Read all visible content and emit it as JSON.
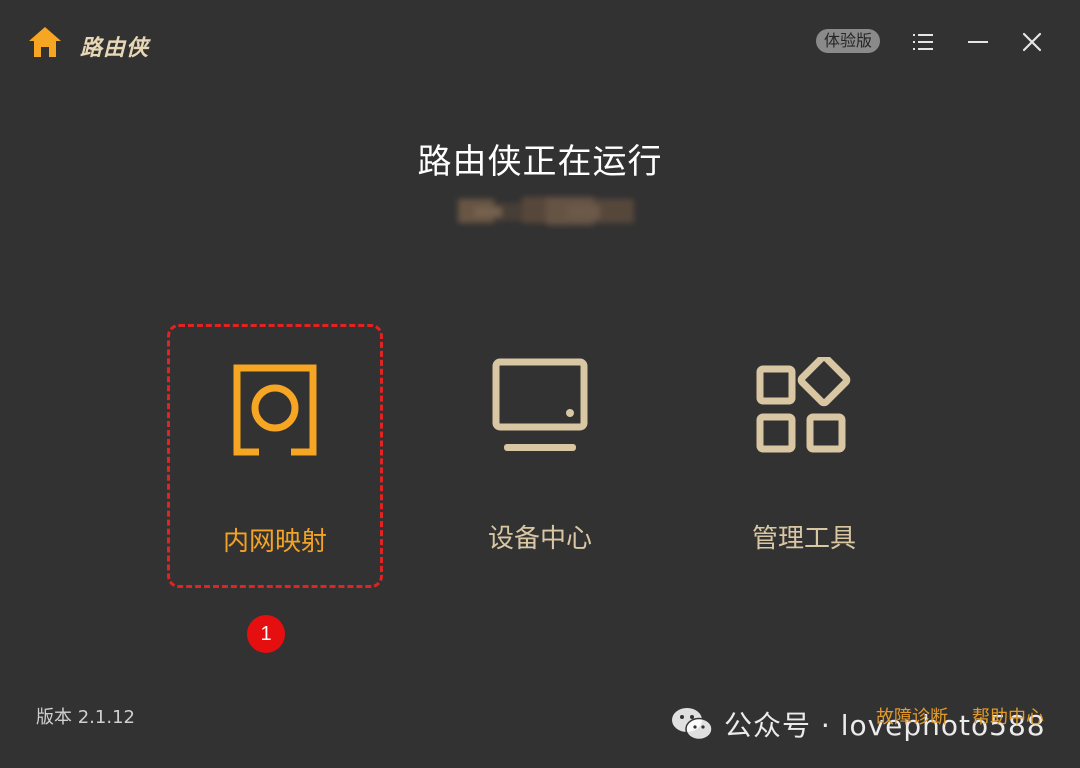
{
  "app": {
    "name": "路由侠",
    "edition_badge": "体验版"
  },
  "status": {
    "title": "路由侠正在运行"
  },
  "features": [
    {
      "label": "内网映射",
      "icon": "port-mapping-icon",
      "selected": true
    },
    {
      "label": "设备中心",
      "icon": "monitor-icon",
      "selected": false
    },
    {
      "label": "管理工具",
      "icon": "apps-grid-icon",
      "selected": false
    }
  ],
  "step_marker": "1",
  "footer": {
    "version": "版本 2.1.12",
    "diagnose_link": "故障诊断",
    "help_link": "帮助中心"
  },
  "watermark": {
    "text": "公众号 · lovephoto588"
  },
  "colors": {
    "background": "#323232",
    "accent_orange": "#f2a227",
    "beige": "#d9c7a4",
    "selection_red": "#e32222"
  }
}
